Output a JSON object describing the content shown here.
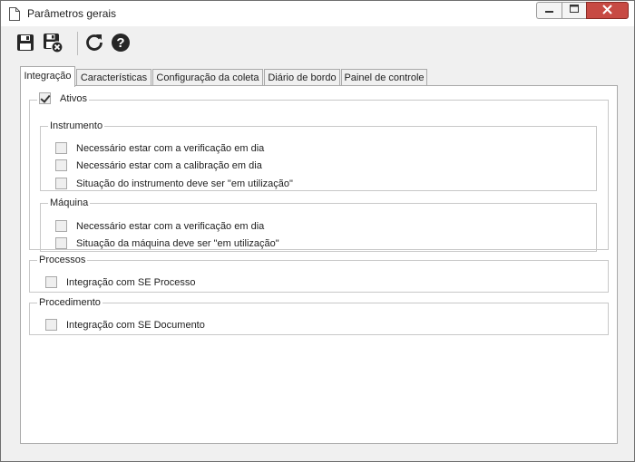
{
  "window": {
    "title": "Parâmetros gerais",
    "icons": {
      "doc": "document-icon",
      "minimize": "minimize-icon",
      "maximize": "maximize-icon",
      "close": "close-icon"
    }
  },
  "toolbar": {
    "buttons": [
      {
        "icon": "save-icon"
      },
      {
        "icon": "save-and-close-icon"
      },
      {
        "icon": "refresh-icon"
      },
      {
        "icon": "help-icon"
      }
    ]
  },
  "tabs": [
    {
      "label": "Integração",
      "active": true
    },
    {
      "label": "Características",
      "active": false
    },
    {
      "label": "Configuração da coleta",
      "active": false
    },
    {
      "label": "Diário de bordo",
      "active": false
    },
    {
      "label": "Painel de controle",
      "active": false
    }
  ],
  "ativos": {
    "label": "Ativos",
    "checked": true,
    "instrumento": {
      "title": "Instrumento",
      "items": [
        {
          "label": "Necessário estar com a verificação em dia",
          "checked": false
        },
        {
          "label": "Necessário estar com a calibração em dia",
          "checked": false
        },
        {
          "label": "Situação do instrumento deve ser \"em utilização\"",
          "checked": false
        }
      ]
    },
    "maquina": {
      "title": "Máquina",
      "items": [
        {
          "label": "Necessário estar com a verificação em dia",
          "checked": false
        },
        {
          "label": "Situação da máquina deve ser \"em utilização\"",
          "checked": false
        }
      ]
    }
  },
  "processos": {
    "title": "Processos",
    "items": [
      {
        "label": "Integração com SE Processo",
        "checked": false
      }
    ]
  },
  "procedimento": {
    "title": "Procedimento",
    "items": [
      {
        "label": "Integração com SE Documento",
        "checked": false
      }
    ]
  }
}
